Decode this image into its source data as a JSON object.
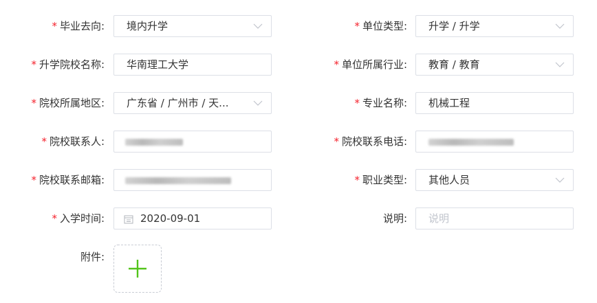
{
  "colors": {
    "required_star": "#f5222d",
    "plus_icon": "#52c41a"
  },
  "rows": {
    "grad_direction": {
      "label": "毕业去向:",
      "value": "境内升学"
    },
    "unit_type": {
      "label": "单位类型:",
      "value": "升学 / 升学"
    },
    "school_name": {
      "label": "升学院校名称:",
      "value": "华南理工大学"
    },
    "unit_industry": {
      "label": "单位所属行业:",
      "value": "教育 / 教育"
    },
    "school_region": {
      "label": "院校所属地区:",
      "value": "广东省 / 广州市 / 天..."
    },
    "major_name": {
      "label": "专业名称:",
      "value": "机械工程"
    },
    "school_contact": {
      "label": "院校联系人:"
    },
    "school_phone": {
      "label": "院校联系电话:"
    },
    "school_email": {
      "label": "院校联系邮箱:"
    },
    "job_type": {
      "label": "职业类型:",
      "value": "其他人员"
    },
    "enroll_date": {
      "label": "入学时间:",
      "value": "2020-09-01"
    },
    "remark": {
      "label": "说明:",
      "placeholder": "说明"
    },
    "attachment": {
      "label": "附件:"
    }
  },
  "required_mark": "*"
}
